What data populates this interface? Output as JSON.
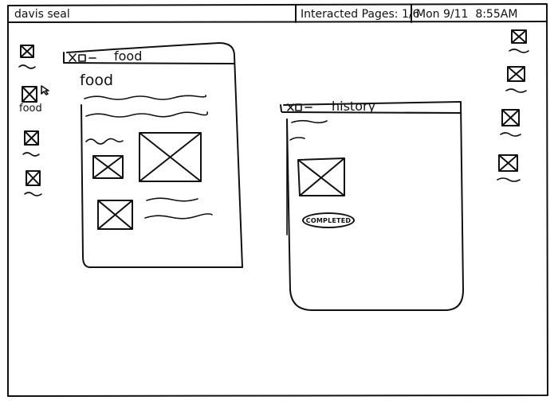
{
  "topbar": {
    "user_name": "davis seal",
    "interacted_pages_label": "Interacted Pages:",
    "interacted_pages_value": "1/6",
    "date": "Mon 9/11",
    "time": "8:55AM"
  },
  "left_desktop_icons": [
    {
      "name": "desktop-icon-1",
      "label": ""
    },
    {
      "name": "desktop-icon-food",
      "label": "food"
    },
    {
      "name": "desktop-icon-3",
      "label": ""
    },
    {
      "name": "desktop-icon-4",
      "label": ""
    }
  ],
  "right_desktop_icons": [
    {
      "name": "desktop-icon-r1"
    },
    {
      "name": "desktop-icon-r2"
    },
    {
      "name": "desktop-icon-r3"
    },
    {
      "name": "desktop-icon-r4"
    }
  ],
  "windows": {
    "food": {
      "title": "food",
      "heading": "food",
      "controls": [
        "close-icon",
        "maximize-icon",
        "minimize-icon"
      ]
    },
    "history": {
      "title": "history",
      "status_badge": "COMPLETED",
      "controls": [
        "close-icon",
        "maximize-icon",
        "minimize-icon"
      ]
    }
  },
  "icons": {
    "image_placeholder": "image-placeholder-icon",
    "cursor": "cursor-icon"
  }
}
